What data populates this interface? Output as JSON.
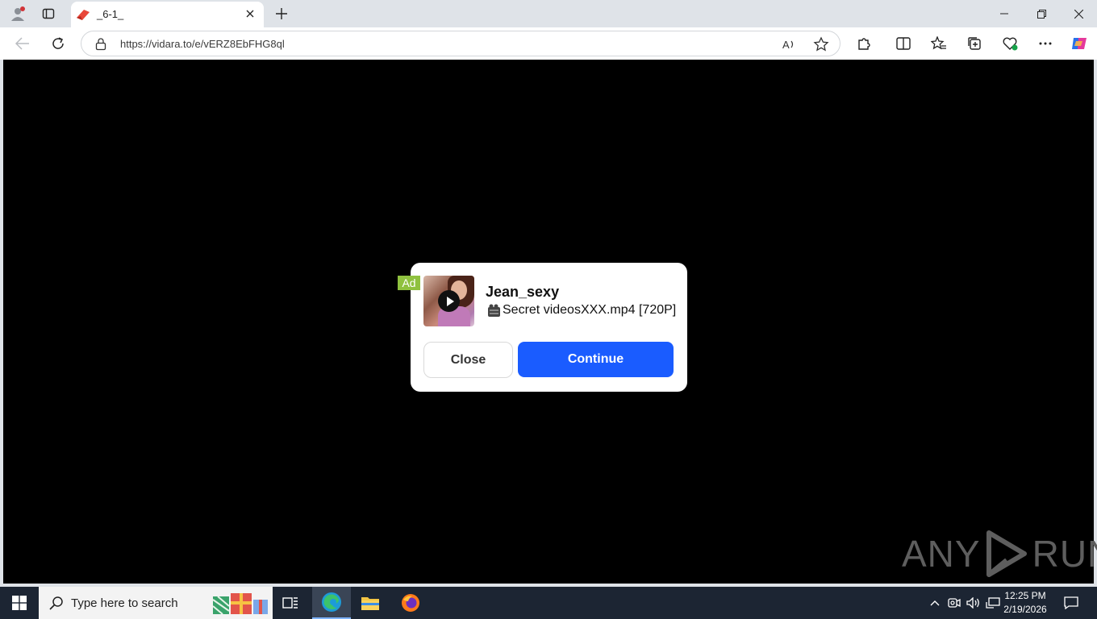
{
  "browser": {
    "tab_title": "_6-1_",
    "url": "https://vidara.to/e/vERZ8EbFHG8ql"
  },
  "ad": {
    "badge": "Ad",
    "name": "Jean_sexy",
    "file": "Secret videosXXX.mp4 [720P]",
    "close_label": "Close",
    "continue_label": "Continue",
    "continue_color": "#1a5cff",
    "badge_color": "#8fc13f"
  },
  "watermark": {
    "left": "ANY",
    "right": "RUN"
  },
  "taskbar": {
    "search_placeholder": "Type here to search",
    "time": "12:25 PM",
    "date": "2/19/2026"
  }
}
